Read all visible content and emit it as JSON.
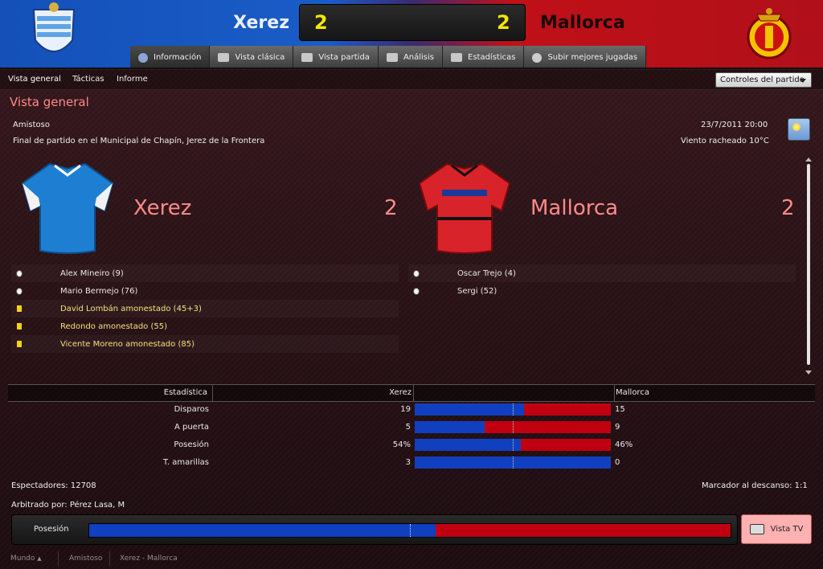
{
  "header": {
    "home_team": "Xerez",
    "away_team": "Mallorca",
    "home_score": "2",
    "away_score": "2",
    "home_color": "#1450b8",
    "away_color": "#c01018"
  },
  "tabs": [
    {
      "label": "Información",
      "icon": "info-icon"
    },
    {
      "label": "Vista clásica",
      "icon": "pitch-icon"
    },
    {
      "label": "Vista partida",
      "icon": "split-view-icon"
    },
    {
      "label": "Análisis",
      "icon": "analysis-icon"
    },
    {
      "label": "Estadísticas",
      "icon": "stats-icon"
    },
    {
      "label": "Subir mejores jugadas",
      "icon": "upload-icon"
    }
  ],
  "subnav": {
    "items": [
      "Vista general",
      "Tácticas",
      "Informe"
    ],
    "controls_label": "Controles del partido"
  },
  "overview": {
    "title": "Vista general",
    "competition": "Amistoso",
    "result_text": "Final de partido en el Municipal de Chapín, Jerez de la Frontera",
    "datetime": "23/7/2011 20:00",
    "weather": "Viento racheado 10°C",
    "home_big_name": "Xerez",
    "home_big_score": "2",
    "away_big_name": "Mallorca",
    "away_big_score": "2"
  },
  "home_events": [
    {
      "type": "goal",
      "text": "Alex Mineiro (9)"
    },
    {
      "type": "goal",
      "text": "Mario Bermejo (76)"
    },
    {
      "type": "yellow",
      "text": "David Lombán amonestado (45+3)"
    },
    {
      "type": "yellow",
      "text": "Redondo amonestado (55)"
    },
    {
      "type": "yellow",
      "text": "Vicente Moreno amonestado (85)"
    }
  ],
  "away_events": [
    {
      "type": "goal",
      "text": "Oscar Trejo (4)"
    },
    {
      "type": "goal",
      "text": "Sergi (52)"
    }
  ],
  "stats": {
    "headers": {
      "label": "Estadística",
      "home": "Xerez",
      "away": "Mallorca"
    },
    "rows": [
      {
        "label": "Disparos",
        "home": "19",
        "away": "15",
        "home_share": 0.559
      },
      {
        "label": "A puerta",
        "home": "5",
        "away": "9",
        "home_share": 0.357
      },
      {
        "label": "Posesión",
        "home": "54%",
        "away": "46%",
        "home_share": 0.54
      },
      {
        "label": "T. amarillas",
        "home": "3",
        "away": "0",
        "home_share": 1.0
      }
    ]
  },
  "info": {
    "spectators": "Espectadores: 12708",
    "halftime": "Marcador al descanso: 1:1",
    "referee": "Arbitrado por: Pérez Lasa, M"
  },
  "possession": {
    "label": "Posesión",
    "home_share": 0.54
  },
  "tv_button": "Vista TV",
  "footer": [
    "Mundo",
    "Amistoso",
    "Xerez - Mallorca"
  ]
}
